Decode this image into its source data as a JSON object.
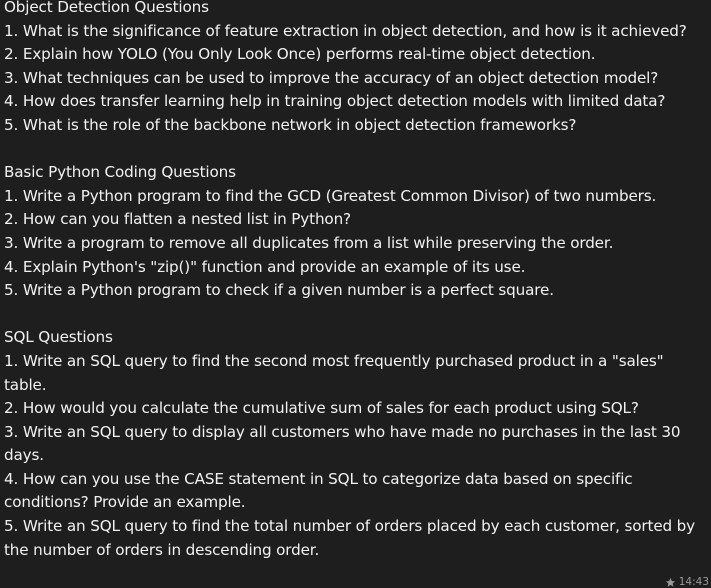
{
  "sections": [
    {
      "title": "Object Detection Questions",
      "questions": [
        "1. What is the significance of feature extraction in object detection, and how is it achieved?",
        "2. Explain how YOLO (You Only Look Once) performs real-time object detection.",
        "3. What techniques can be used to improve the accuracy of an object detection model?",
        "4. How does transfer learning help in training object detection models with limited data?",
        "5. What is the role of the backbone network in object detection frameworks?"
      ]
    },
    {
      "title": "Basic Python Coding Questions",
      "questions": [
        "1. Write a Python program to find the GCD (Greatest Common Divisor) of two numbers.",
        "2. How can you flatten a nested list in Python?",
        "3. Write a program to remove all duplicates from a list while preserving the order.",
        "4. Explain Python's \"zip()\" function and provide an example of its use.",
        "5. Write a Python program to check if a given number is a perfect square."
      ]
    },
    {
      "title": "SQL Questions",
      "questions": [
        "1. Write an SQL query to find the second most frequently purchased product in a \"sales\" table.",
        "2. How would you calculate the cumulative sum of sales for each product using SQL?",
        "3. Write an SQL query to display all customers who have made no purchases in the last 30 days.",
        "4. How can you use the CASE statement in SQL to categorize data based on specific conditions? Provide an example.",
        "5. Write an SQL query to find the total number of orders placed by each customer, sorted by the number of orders in descending order."
      ]
    }
  ],
  "meta": {
    "time": "14:43",
    "icon": "star-icon"
  }
}
